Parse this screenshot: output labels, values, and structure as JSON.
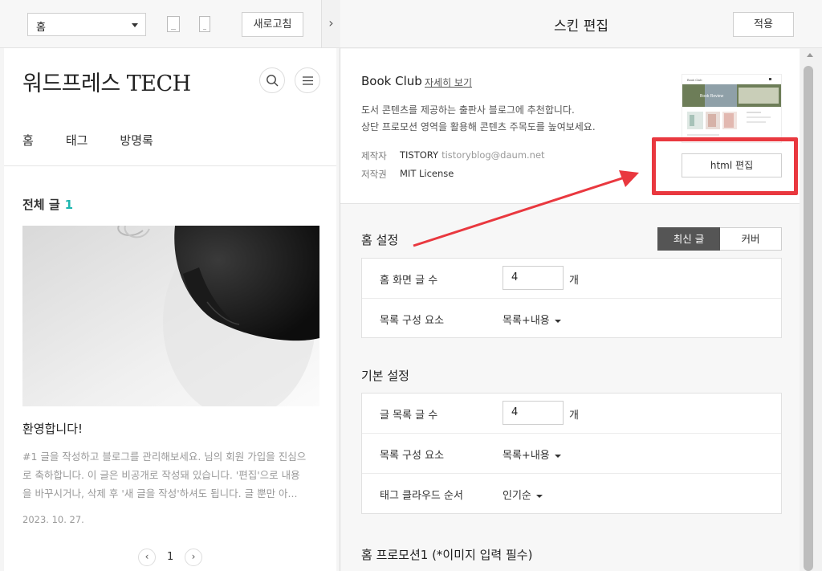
{
  "preview_toolbar": {
    "page_select_value": "홈",
    "refresh_label": "새로고침",
    "collapse_glyph": "›"
  },
  "blog": {
    "title": "워드프레스 TECH",
    "nav": [
      "홈",
      "태그",
      "방명록"
    ],
    "all_posts_label": "전체 글",
    "all_posts_count": "1",
    "post": {
      "title": "환영합니다!",
      "excerpt": "#1 글을 작성하고 블로그를 관리해보세요. 님의 회원 가입을 진심으로 축하합니다. 이 글은 비공개로 작성돼 있습니다. '편집'으로 내용을 바꾸시거나, 삭제 후 '새 글을 작성'하셔도 됩니다. 글 뿐만 아...",
      "date": "2023. 10. 27."
    },
    "pagination": {
      "prev": "‹",
      "page": "1",
      "next": "›"
    }
  },
  "editor": {
    "title": "스킨 편집",
    "apply_label": "적용",
    "skin": {
      "name": "Book Club",
      "detail_link": "자세히 보기",
      "desc_line1": "도서 콘텐츠를 제공하는 출판사 블로그에 추천합니다.",
      "desc_line2": "상단 프로모션 영역을 활용해 콘텐츠 주목도를 높여보세요.",
      "maker_label": "제작자",
      "maker_name": "TISTORY",
      "maker_email": "tistoryblog@daum.net",
      "license_label": "저작권",
      "license_value": "MIT License",
      "html_edit_label": "html 편집",
      "thumb_brand": "Book Club",
      "thumb_banner": "Book Review"
    },
    "home_settings": {
      "title": "홈 설정",
      "toggle": [
        "최신 글",
        "커버"
      ],
      "toggle_active": "최신 글",
      "rows": [
        {
          "label": "홈 화면 글 수",
          "value": "4",
          "unit": "개"
        },
        {
          "label": "목록 구성 요소",
          "value": "목록+내용"
        }
      ]
    },
    "basic_settings": {
      "title": "기본 설정",
      "rows": [
        {
          "label": "글 목록 글 수",
          "value": "4",
          "unit": "개"
        },
        {
          "label": "목록 구성 요소",
          "value": "목록+내용"
        },
        {
          "label": "태그 클라우드 순서",
          "value": "인기순"
        }
      ]
    },
    "promo_title": "홈 프로모션1 (*이미지 입력 필수)"
  },
  "annotation": {
    "color": "#e9383f"
  }
}
